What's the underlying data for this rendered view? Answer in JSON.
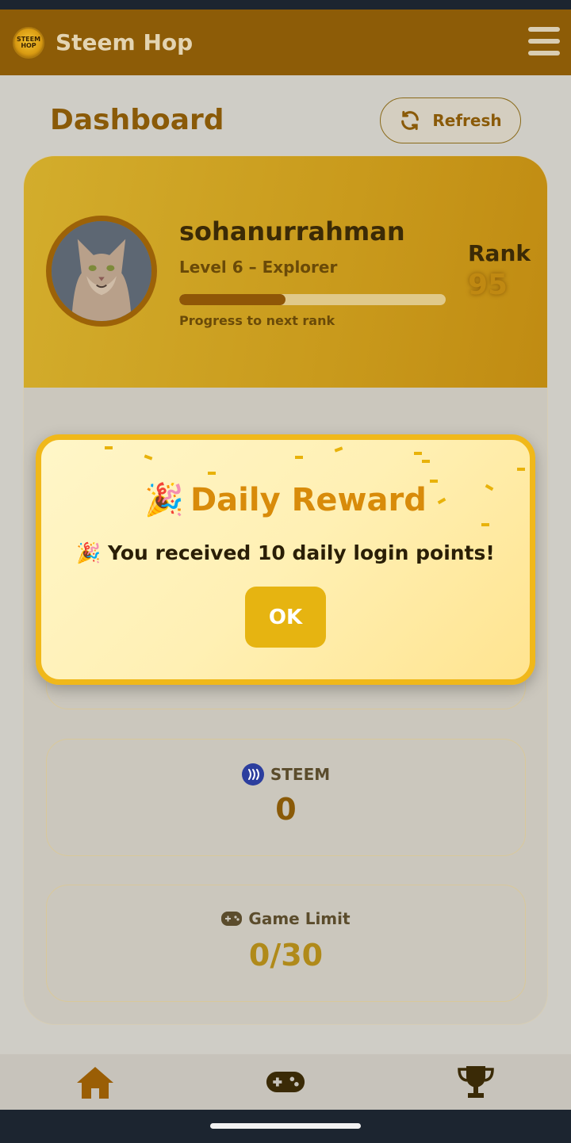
{
  "header": {
    "logo_text": "STEEM HOP",
    "title": "Steem Hop",
    "menu_icon": "hamburger-menu-icon"
  },
  "dashboard": {
    "title": "Dashboard",
    "refresh_label": "Refresh",
    "refresh_icon": "refresh-icon"
  },
  "profile": {
    "username": "sohanurrahman",
    "level": "Level 6 – Explorer",
    "progress_label": "Progress to next rank",
    "progress_fraction": 0.4,
    "rank_label": "Rank",
    "rank_value": "95"
  },
  "stats": [
    {
      "label": "",
      "value": ""
    },
    {
      "label": "STEEM",
      "value": "0",
      "icon": "steem-icon"
    },
    {
      "label": "Game Limit",
      "value": "0/30",
      "icon": "gamepad-icon"
    }
  ],
  "modal": {
    "title": "Daily Reward",
    "message": "You received 10 daily login points!",
    "ok_label": "OK",
    "title_icon": "party-popper-icon"
  },
  "bottom_nav": [
    {
      "name": "home",
      "icon": "home-icon",
      "color": "#9a5e05"
    },
    {
      "name": "games",
      "icon": "gamepad-icon",
      "color": "#3a2a06"
    },
    {
      "name": "leaderboard",
      "icon": "trophy-icon",
      "color": "#3a2a06"
    }
  ],
  "colors": {
    "header_bg": "#8d5c07",
    "accent": "#f0b81a",
    "ok_button": "#e6b411",
    "brand_brown": "#8a5a08"
  }
}
